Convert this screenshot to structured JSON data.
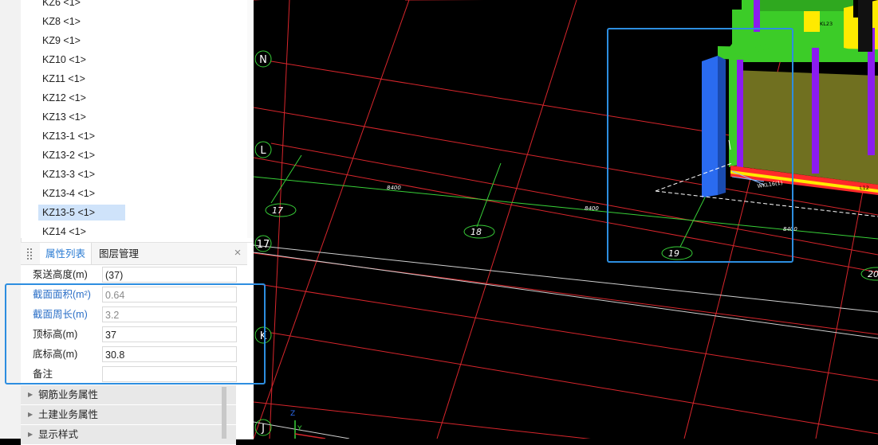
{
  "component_list": {
    "items": [
      {
        "label": "KZ6 <1>",
        "selected": false
      },
      {
        "label": "KZ8 <1>",
        "selected": false
      },
      {
        "label": "KZ9 <1>",
        "selected": false
      },
      {
        "label": "KZ10 <1>",
        "selected": false
      },
      {
        "label": "KZ11 <1>",
        "selected": false
      },
      {
        "label": "KZ12 <1>",
        "selected": false
      },
      {
        "label": "KZ13 <1>",
        "selected": false
      },
      {
        "label": "KZ13-1 <1>",
        "selected": false
      },
      {
        "label": "KZ13-2 <1>",
        "selected": false
      },
      {
        "label": "KZ13-3 <1>",
        "selected": false
      },
      {
        "label": "KZ13-4 <1>",
        "selected": false
      },
      {
        "label": "KZ13-5 <1>",
        "selected": true
      },
      {
        "label": "KZ14 <1>",
        "selected": false
      }
    ]
  },
  "panel": {
    "tabs": [
      {
        "label": "属性列表",
        "active": true
      },
      {
        "label": "图层管理",
        "active": false
      }
    ],
    "close_symbol": "×"
  },
  "properties": [
    {
      "name": "泵送高度(m)",
      "value": "(37)",
      "highlight": false
    },
    {
      "name": "截面面积(m²)",
      "value": "0.64",
      "highlight": true
    },
    {
      "name": "截面周长(m)",
      "value": "3.2",
      "highlight": true
    },
    {
      "name": "顶标高(m)",
      "value": "37",
      "highlight": false
    },
    {
      "name": "底标高(m)",
      "value": "30.8",
      "highlight": false
    },
    {
      "name": "备注",
      "value": "",
      "highlight": false
    }
  ],
  "groups": [
    {
      "label": "钢筋业务属性"
    },
    {
      "label": "土建业务属性"
    },
    {
      "label": "显示样式"
    }
  ],
  "viewport": {
    "axis_labels": [
      "N",
      "L",
      "17",
      "K",
      "J"
    ],
    "grid_bubbles": [
      "17",
      "18",
      "19",
      "20"
    ],
    "dimensions": [
      "8400",
      "8400",
      "8400"
    ],
    "beam_labels": [
      "KL23",
      "WKL16(1)",
      "L12"
    ],
    "axis_letters": [
      "Z",
      "Y"
    ]
  },
  "colors": {
    "accent": "#2d8ee0",
    "selection": "#cfe3fa",
    "grid_red": "#d8262c",
    "grid_white": "#d0d0d0",
    "dim_green": "#38d038",
    "column_blue": "#2a6bf0",
    "wall_olive": "#707020",
    "beam_green": "#3ccc28",
    "rebar_purple": "#8b1cf0",
    "slab_yellow": "#ffea00",
    "slab_red": "#ff2a2a"
  }
}
